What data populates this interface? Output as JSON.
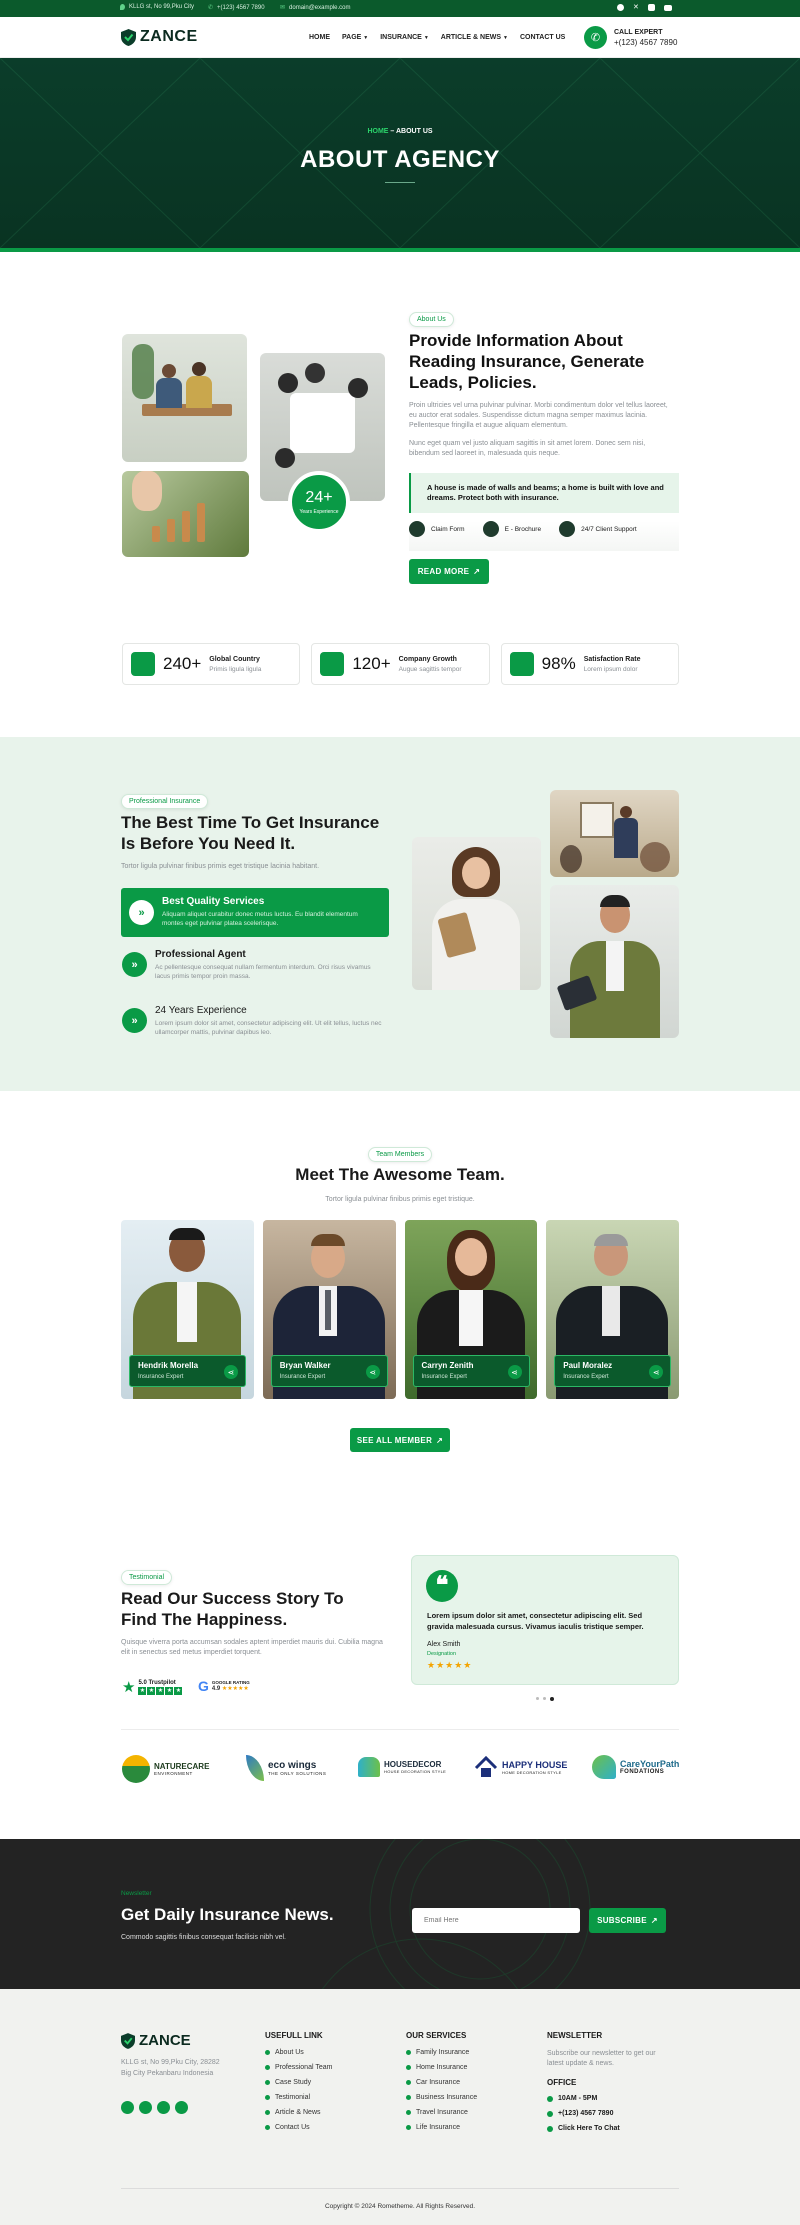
{
  "topbar": {
    "address": "KLLG st, No 99,Pku City",
    "phone": "+(123) 4567 7890",
    "email": "domain@example.com"
  },
  "header": {
    "logo": "ZANCE",
    "nav": [
      "HOME",
      "PAGE",
      "INSURANCE",
      "ARTICLE & NEWS",
      "CONTACT US"
    ],
    "call_label": "CALL EXPERT",
    "call_number": "+(123) 4567 7890"
  },
  "hero": {
    "crumb_home": "HOME",
    "crumb_sep": " – ",
    "crumb_current": "ABOUT US",
    "title": "ABOUT AGENCY"
  },
  "about": {
    "tag": "About Us",
    "title": "Provide Information About Reading Insurance, Generate Leads, Policies.",
    "p1": "Proin ultricies vel urna pulvinar pulvinar. Morbi condimentum dolor vel tellus laoreet, eu auctor erat sodales. Suspendisse dictum magna semper maximus lacinia. Pellentesque fringilla et augue aliquam elementum.",
    "p2": "Nunc eget quam vel justo aliquam sagittis in sit amet lorem. Donec sem nisi, bibendum sed laoreet in, malesuada quis neque.",
    "quote": "A house is made of walls and beams; a home is built with love and dreams. Protect both with insurance.",
    "features": [
      "Claim Form",
      "E - Brochure",
      "24/7 Client Support"
    ],
    "cta": "READ MORE",
    "badge_value": "24+",
    "badge_label": "Years Experience"
  },
  "stats": [
    {
      "value": "240+",
      "title": "Global Country",
      "sub": "Primis ligula ligula"
    },
    {
      "value": "120+",
      "title": "Company Growth",
      "sub": "Augue sagittis tempor"
    },
    {
      "value": "98%",
      "title": "Satisfaction Rate",
      "sub": "Lorem ipsum dolor"
    }
  ],
  "why": {
    "tag": "Professional Insurance",
    "title": "The Best Time To Get Insurance Is Before You Need It.",
    "intro": "Tortor ligula pulvinar finibus primis eget tristique lacinia habitant.",
    "items": [
      {
        "title": "Best Quality Services",
        "text": "Aliquam aliquet curabitur donec metus luctus. Eu blandit elementum montes eget pulvinar platea scelerisque."
      },
      {
        "title": "Professional Agent",
        "text": "Ac pellentesque consequat nullam fermentum interdum. Orci risus vivamus lacus primis tempor proin massa."
      },
      {
        "title": "24 Years Experience",
        "text": "Lorem ipsum dolor sit amet, consectetur adipiscing elit. Ut elit tellus, luctus nec ullamcorper mattis, pulvinar dapibus leo."
      }
    ]
  },
  "team": {
    "tag": "Team Members",
    "title": "Meet The Awesome Team.",
    "sub": "Tortor ligula pulvinar finibus primis eget tristique.",
    "members": [
      {
        "name": "Hendrik Morella",
        "role": "Insurance Expert"
      },
      {
        "name": "Bryan Walker",
        "role": "Insurance Expert"
      },
      {
        "name": "Carryn Zenith",
        "role": "Insurance Expert"
      },
      {
        "name": "Paul Moralez",
        "role": "Insurance Expert"
      }
    ],
    "cta": "SEE ALL MEMBER"
  },
  "testimonial": {
    "tag": "Testimonial",
    "title": "Read Our Success Story To Find The Happiness.",
    "text": "Quisque viverra porta accumsan sodales aptent imperdiet mauris dui. Cubilia magna elit in senectus sed metus imperdiet torquent.",
    "trustpilot": "5.0 Trustpilot",
    "google": "GOOGLE RATING",
    "google_score": "4.9",
    "quote": "Lorem ipsum dolor sit amet, consectetur adipiscing elit. Sed gravida malesuada cursus. Vivamus iaculis tristique semper.",
    "author": "Alex Smith",
    "author_role": "Designation"
  },
  "brands": [
    {
      "name": "NATURECARE",
      "sub": "ENVIRONMENT"
    },
    {
      "name": "eco wings",
      "sub": "THE ONLY SOLUTIONS"
    },
    {
      "name": "HOUSEDECOR",
      "sub": "HOUSE DECORATION STYLE"
    },
    {
      "name": "HAPPY HOUSE",
      "sub": "HOME DECORATION STYLE"
    },
    {
      "name": "CareYourPath",
      "sub": "FONDATIONS"
    }
  ],
  "newsletter": {
    "tag": "Newsletter",
    "title": "Get Daily Insurance News.",
    "sub": "Commodo sagittis finibus consequat facilisis nibh vel.",
    "placeholder": "Email Here",
    "cta": "SUBSCRIBE"
  },
  "footer": {
    "logo": "ZANCE",
    "address": "KLLG st, No 99,Pku City, 28282 Big City Pekanbaru Indonesia",
    "col1_title": "USEFULL LINK",
    "col1": [
      "About Us",
      "Professional Team",
      "Case Study",
      "Testimonial",
      "Article & News",
      "Contact Us"
    ],
    "col2_title": "OUR SERVICES",
    "col2": [
      "Family Insurance",
      "Home Insurance",
      "Car Insurance",
      "Business Insurance",
      "Travel Insurance",
      "Life Insurance"
    ],
    "col3_title": "NEWSLETTER",
    "col3_text": "Subscribe our newsletter to get our latest update & news.",
    "office_title": "OFFICE",
    "office": [
      "10AM - 5PM",
      "+(123) 4567 7890",
      "Click Here To Chat"
    ],
    "copyright": "Copyright © 2024 Rometheme. All Rights Reserved."
  },
  "colors": {
    "green": "#0a9a46",
    "dark_green": "#0b3d2a",
    "light_green": "#e6f4ea"
  }
}
